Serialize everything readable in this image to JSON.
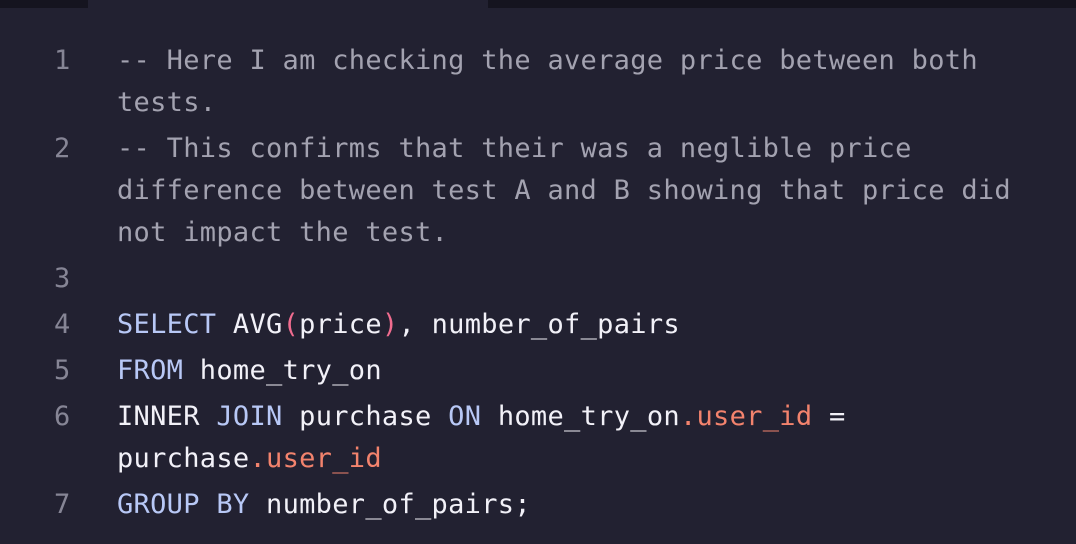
{
  "colors": {
    "background": "#222131",
    "comment": "#a3a2b0",
    "keyword": "#b8c8f6",
    "paren": "#f06c8f",
    "property": "#f3836d",
    "text": "#f2f1f8",
    "line_number": "#868595"
  },
  "lines": [
    {
      "number": "1",
      "tokens": [
        {
          "type": "comment",
          "text": "-- Here I am checking the average price between both tests."
        }
      ]
    },
    {
      "number": "2",
      "tokens": [
        {
          "type": "comment",
          "text": "-- This confirms that their was a neglible price difference between test A and B showing that price did not impact the test."
        }
      ]
    },
    {
      "number": "3",
      "tokens": []
    },
    {
      "number": "4",
      "tokens": [
        {
          "type": "kw",
          "text": "SELECT"
        },
        {
          "type": "plain",
          "text": " AVG"
        },
        {
          "type": "paren",
          "text": "("
        },
        {
          "type": "plain",
          "text": "price"
        },
        {
          "type": "paren",
          "text": ")"
        },
        {
          "type": "plain",
          "text": ", number_of_pairs"
        }
      ]
    },
    {
      "number": "5",
      "tokens": [
        {
          "type": "kw",
          "text": "FROM"
        },
        {
          "type": "plain",
          "text": " home_try_on"
        }
      ]
    },
    {
      "number": "6",
      "tokens": [
        {
          "type": "plain",
          "text": "INNER "
        },
        {
          "type": "kw",
          "text": "JOIN"
        },
        {
          "type": "plain",
          "text": " purchase "
        },
        {
          "type": "kw",
          "text": "ON"
        },
        {
          "type": "plain",
          "text": " home_try_on"
        },
        {
          "type": "prop",
          "text": ".user_id"
        },
        {
          "type": "plain",
          "text": " = purchase"
        },
        {
          "type": "prop",
          "text": ".user_id"
        }
      ]
    },
    {
      "number": "7",
      "tokens": [
        {
          "type": "kw",
          "text": "GROUP BY"
        },
        {
          "type": "plain",
          "text": " number_of_pairs;"
        }
      ]
    }
  ]
}
